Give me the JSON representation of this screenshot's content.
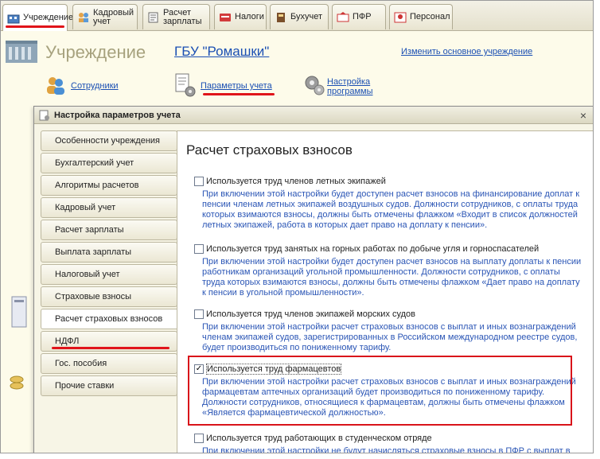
{
  "tabs": [
    {
      "label": "Учреждение",
      "icon": "institution-icon"
    },
    {
      "label": "Кадровый учет",
      "icon": "people-icon"
    },
    {
      "label": "Расчет зарплаты",
      "icon": "payroll-icon"
    },
    {
      "label": "Налоги",
      "icon": "taxes-icon"
    },
    {
      "label": "Бухучет",
      "icon": "accounting-icon"
    },
    {
      "label": "ПФР",
      "icon": "pension-fund-icon"
    },
    {
      "label": "Персонал",
      "icon": "staff-icon"
    }
  ],
  "header": {
    "title": "Учреждение",
    "org_name": "ГБУ \"Ромашки\"",
    "change_org": "Изменить основное учреждение",
    "links": {
      "employees": "Сотрудники",
      "accounting_params": "Параметры учета",
      "program_settings": "Настройка программы"
    }
  },
  "dialog": {
    "title": "Настройка параметров учета",
    "close": "×",
    "nav": [
      "Особенности учреждения",
      "Бухгалтерский учет",
      "Алгоритмы расчетов",
      "Кадровый учет",
      "Расчет зарплаты",
      "Выплата зарплаты",
      "Налоговый учет",
      "Страховые взносы",
      "Расчет страховых взносов",
      "НДФЛ",
      "Гос. пособия",
      "Прочие ставки"
    ],
    "active_nav": "Расчет страховых взносов",
    "content_title": "Расчет страховых взносов",
    "options": [
      {
        "label": "Используется труд членов летных экипажей",
        "checked": false,
        "desc": "При включении этой настройки будет доступен расчет взносов на финансирование доплат к пенсии членам летных экипажей воздушных судов. Должности сотрудников, с оплаты труда которых взимаются взносы, должны быть отмечены флажком «Входит в список должностей летных экипажей, работа в которых дает право на доплату к пенсии»."
      },
      {
        "label": "Используется труд занятых на горных работах по добыче угля и горноспасателей",
        "checked": false,
        "desc": "При включении этой настройки будет доступен расчет взносов на выплату доплаты к пенсии работникам организаций угольной промышленности. Должности сотрудников, с оплаты труда которых взимаются взносы, должны быть отмечены флажком «Дает право на доплату к пенсии в угольной промышленности»."
      },
      {
        "label": "Используется труд членов экипажей морских судов",
        "checked": false,
        "desc": "При включении этой настройки расчет страховых взносов с выплат и иных вознаграждений членам экипажей судов, зарегистрированных в Российском международном реестре судов, будет производиться по пониженному тарифу."
      },
      {
        "label": "Используется труд фармацевтов",
        "checked": true,
        "desc": "При включении этой настройки расчет страховых взносов с выплат и иных вознаграждений фармацевтам аптечных организаций будет производиться по пониженному тарифу. Должности сотрудников, относящиеся к фармацевтам, должны быть отмечены флажком «Является фармацевтической должностью»."
      },
      {
        "label": "Используется труд работающих в студенческом отряде",
        "checked": false,
        "desc": "При включении этой настройки не будут начисляться страховые взносы в ПФР с выплат в"
      }
    ]
  },
  "colors": {
    "accent_red": "#d9141a",
    "link_blue": "#1a4fb3",
    "desc_blue": "#2a55b5"
  }
}
